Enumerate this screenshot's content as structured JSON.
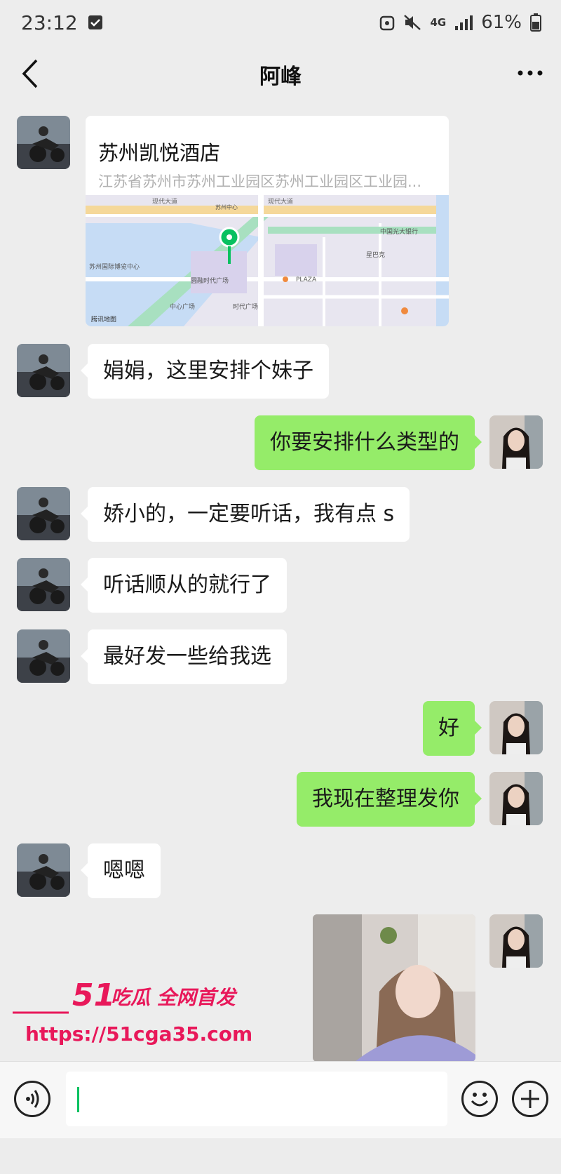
{
  "status_bar": {
    "time": "23:12",
    "network": "4G",
    "battery": "61%"
  },
  "header": {
    "title": "阿峰"
  },
  "location_card": {
    "name": "苏州凯悦酒店",
    "address": "江苏省苏州市苏州工业园区苏州工业园区工业园...",
    "map_labels": {
      "road_top": "现代大道",
      "road_top_right": "现代大道",
      "place_1": "苏州国际博览中心",
      "place_2": "中国光大银行",
      "place_3": "星巴克",
      "place_4": "圆融时代广场",
      "place_5": "PLAZA",
      "place_6": "苏州中心",
      "place_7": "时代广场",
      "place_8": "中心广场",
      "map_source": "腾讯地图"
    }
  },
  "messages": [
    {
      "side": "left",
      "text": "娟娟，这里安排个妹子"
    },
    {
      "side": "right",
      "text": "你要安排什么类型的"
    },
    {
      "side": "left",
      "text": "娇小的，一定要听话，我有点 s"
    },
    {
      "side": "left",
      "text": "听话顺从的就行了"
    },
    {
      "side": "left",
      "text": "最好发一些给我选"
    },
    {
      "side": "right",
      "text": "好"
    },
    {
      "side": "right",
      "text": "我现在整理发你"
    },
    {
      "side": "left",
      "text": "嗯嗯"
    }
  ],
  "watermark": {
    "line1_num": "51",
    "line1_text": "吃瓜 全网首发",
    "line2": "https://51cga35.com"
  },
  "colors": {
    "background": "#ededed",
    "bubble_right": "#95ec69",
    "bubble_left": "#ffffff",
    "watermark": "#e8185a",
    "caret": "#07c160"
  },
  "icons": {
    "back": "chevron-left-icon",
    "more": "more-dots-icon",
    "voice": "voice-icon",
    "emoji": "emoji-icon",
    "plus": "plus-icon"
  }
}
